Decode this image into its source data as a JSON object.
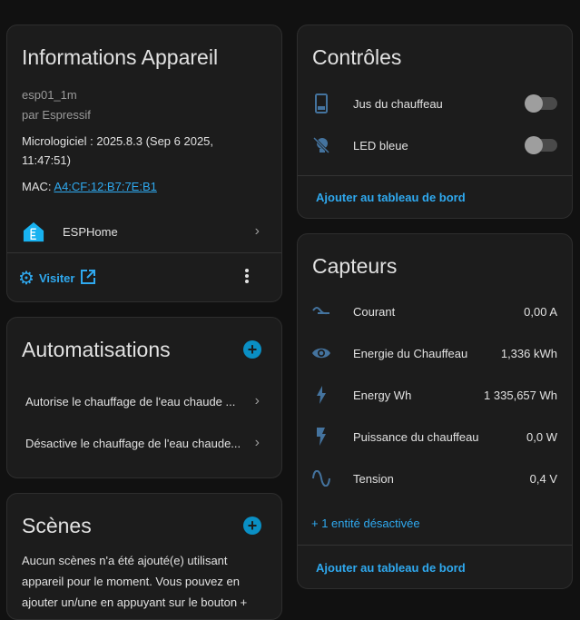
{
  "device_info": {
    "title": "Informations Appareil",
    "model": "esp01_1m",
    "manufacturer": "par Espressif",
    "firmware_line1": "Micrologiciel : 2025.8.3 (Sep 6 2025,",
    "firmware_line2": "11:47:51)",
    "mac_label": "MAC:",
    "mac_value": "A4:CF:12:B7:7E:B1",
    "integration": "ESPHome",
    "visit_label": "Visiter"
  },
  "automations": {
    "title": "Automatisations",
    "items": [
      "Autorise le chauffage de l'eau chaude ...",
      "Désactive le chauffage de l'eau chaude..."
    ]
  },
  "scenes": {
    "title": "Scènes",
    "empty_text": "Aucun scènes n'a été ajouté(e) utilisant appareil pour le moment. Vous pouvez en ajouter un/une en appuyant sur le bouton +"
  },
  "controls": {
    "title": "Contrôles",
    "items": [
      {
        "label": "Jus du chauffeau",
        "on": false
      },
      {
        "label": "LED bleue",
        "on": false
      }
    ],
    "add_dashboard": "Ajouter au tableau de bord"
  },
  "sensors": {
    "title": "Capteurs",
    "items": [
      {
        "label": "Courant",
        "value": "0,00 A"
      },
      {
        "label": "Energie du Chauffeau",
        "value": "1,336 kWh"
      },
      {
        "label": "Energy Wh",
        "value": "1 335,657 Wh"
      },
      {
        "label": "Puissance du chauffeau",
        "value": "0,0 W"
      },
      {
        "label": "Tension",
        "value": "0,4 V"
      }
    ],
    "disabled_entities": "+ 1 entité désactivée",
    "add_dashboard": "Ajouter au tableau de bord"
  },
  "colors": {
    "accent": "#2fa9ef",
    "icon": "#44739e",
    "card": "#1c1c1c",
    "background": "#111111"
  }
}
